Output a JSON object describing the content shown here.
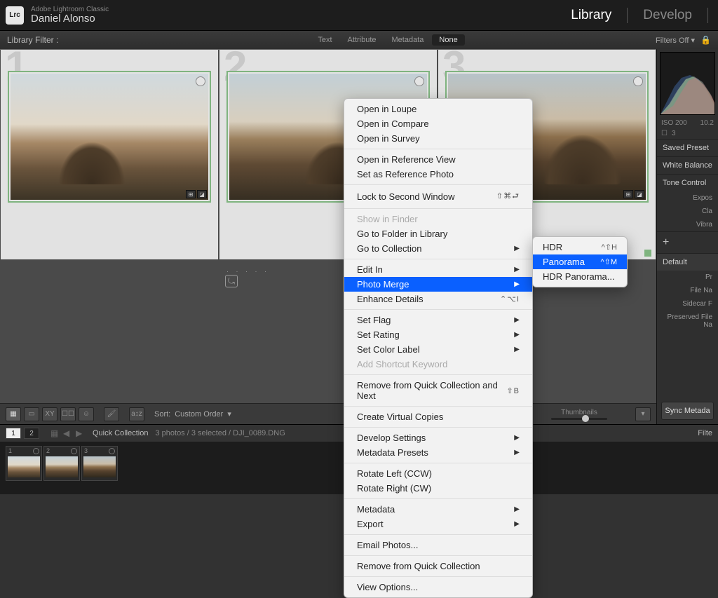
{
  "header": {
    "logo": "Lrc",
    "app_title": "Adobe Lightroom Classic",
    "user_name": "Daniel Alonso",
    "modules": {
      "library": "Library",
      "develop": "Develop"
    }
  },
  "filterbar": {
    "label": "Library Filter :",
    "tabs": {
      "text": "Text",
      "attribute": "Attribute",
      "metadata": "Metadata",
      "none": "None"
    },
    "filters_off": "Filters Off",
    "lock": "🔒"
  },
  "grid": {
    "cells": [
      {
        "num": "1"
      },
      {
        "num": "2"
      },
      {
        "num": "3"
      }
    ]
  },
  "toolbar": {
    "sort_label": "Sort:",
    "sort_value": "Custom Order",
    "thumbnails_label": "Thumbnails"
  },
  "filmstrip": {
    "pages": [
      "1",
      "2"
    ],
    "collection": "Quick Collection",
    "count_text": "3 photos / 3 selected / DJI_0089.DNG",
    "filter_label": "Filte",
    "thumbs": [
      "1",
      "2",
      "3"
    ]
  },
  "rightpanel": {
    "iso": "ISO 200",
    "focal": "10.2",
    "stack_count": "3",
    "sections": {
      "saved_preset": "Saved Preset",
      "white_balance": "White Balance",
      "tone_control": "Tone Control",
      "exposure": "Expos",
      "clarity": "Cla",
      "vibrance": "Vibra",
      "default": "Default",
      "preset_short": "Pr",
      "file_name": "File Na",
      "sidecar": "Sidecar F",
      "preserved": "Preserved File Na"
    },
    "sync_button": "Sync Metada"
  },
  "context_menu": {
    "open_in_loupe": "Open in Loupe",
    "open_in_compare": "Open in Compare",
    "open_in_survey": "Open in Survey",
    "open_ref_view": "Open in Reference View",
    "set_ref_photo": "Set as Reference Photo",
    "lock_second": "Lock to Second Window",
    "lock_short": "⇧⌘⮐",
    "show_finder": "Show in Finder",
    "go_folder": "Go to Folder in Library",
    "go_collection": "Go to Collection",
    "edit_in": "Edit In",
    "photo_merge": "Photo Merge",
    "enhance_details": "Enhance Details",
    "enhance_short": "⌃⌥I",
    "set_flag": "Set Flag",
    "set_rating": "Set Rating",
    "set_color": "Set Color Label",
    "add_shortcut": "Add Shortcut Keyword",
    "remove_qc_next": "Remove from Quick Collection and Next",
    "remove_qc_short": "⇧B",
    "create_vc": "Create Virtual Copies",
    "dev_settings": "Develop Settings",
    "meta_presets": "Metadata Presets",
    "rotate_left": "Rotate Left (CCW)",
    "rotate_right": "Rotate Right (CW)",
    "metadata": "Metadata",
    "export": "Export",
    "email": "Email Photos...",
    "remove_qc": "Remove from Quick Collection",
    "view_options": "View Options..."
  },
  "submenu": {
    "hdr": "HDR",
    "hdr_short": "^⇧H",
    "panorama": "Panorama",
    "panorama_short": "^⇧M",
    "hdr_pano": "HDR Panorama..."
  }
}
